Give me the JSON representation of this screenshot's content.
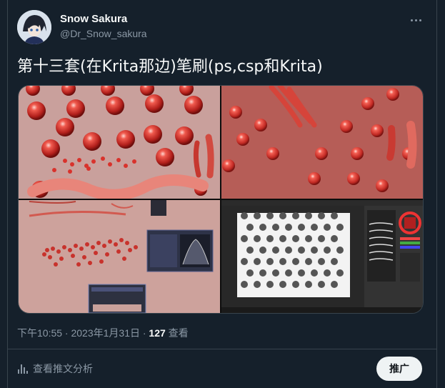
{
  "author": {
    "name": "Snow Sakura",
    "handle": "@Dr_Snow_sakura"
  },
  "tweet": {
    "text": "第十三套(在Krita那边)笔刷(ps,csp和Krita)"
  },
  "meta": {
    "time": "下午10:55 · 2023年1月31日 · ",
    "views_count": "127",
    "views_label": " 查看"
  },
  "actions": {
    "analytics_label": "查看推文分析",
    "promote_label": "推广"
  },
  "colors": {
    "background": "#15202b",
    "secondary_text": "#8b98a5",
    "sphere": "#d43a35",
    "panel_dark": "#2b2b2b"
  },
  "icons": {
    "more": "more-horizontal-icon",
    "analytics": "bar-chart-icon"
  }
}
